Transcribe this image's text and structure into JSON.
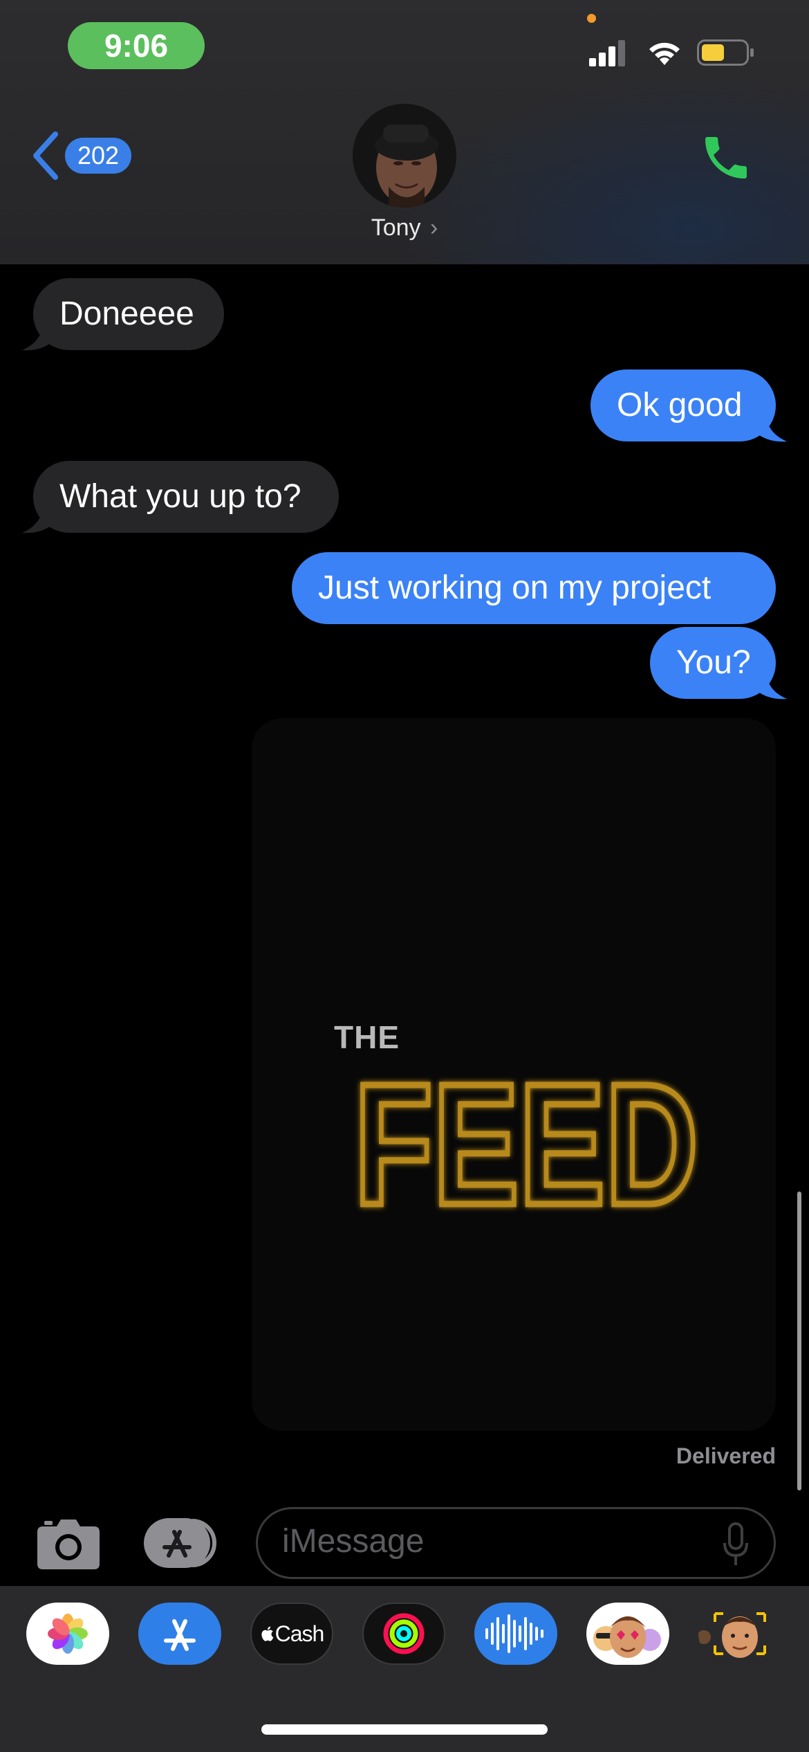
{
  "status_bar": {
    "time": "9:06",
    "icons": [
      "signal-icon",
      "wifi-icon",
      "battery-icon"
    ]
  },
  "header": {
    "back_count": "202",
    "contact_name": "Tony",
    "chevron": "›",
    "icons": [
      "back-chevron-icon",
      "phone-icon"
    ]
  },
  "messages": [
    {
      "direction": "incoming",
      "text": "Doneeee"
    },
    {
      "direction": "outgoing",
      "text": "Ok good"
    },
    {
      "direction": "incoming",
      "text": "What you up to?"
    },
    {
      "direction": "outgoing",
      "text": "Just working on my project"
    },
    {
      "direction": "outgoing",
      "text": "You?"
    }
  ],
  "attachment": {
    "line1": "THE",
    "line2": "FEED"
  },
  "status": {
    "delivered": "Delivered"
  },
  "compose": {
    "placeholder": "iMessage"
  },
  "app_drawer": {
    "apps": [
      "photos",
      "app-store",
      "apple-cash",
      "activity",
      "voice-memo",
      "memoji-stickers",
      "memoji"
    ],
    "cash_label": "Cash"
  },
  "colors": {
    "outgoing": "#3b82f6",
    "incoming": "#262629",
    "time_pill": "#5cbf5d",
    "accent": "#3a7fe7",
    "phone": "#30c85a"
  }
}
